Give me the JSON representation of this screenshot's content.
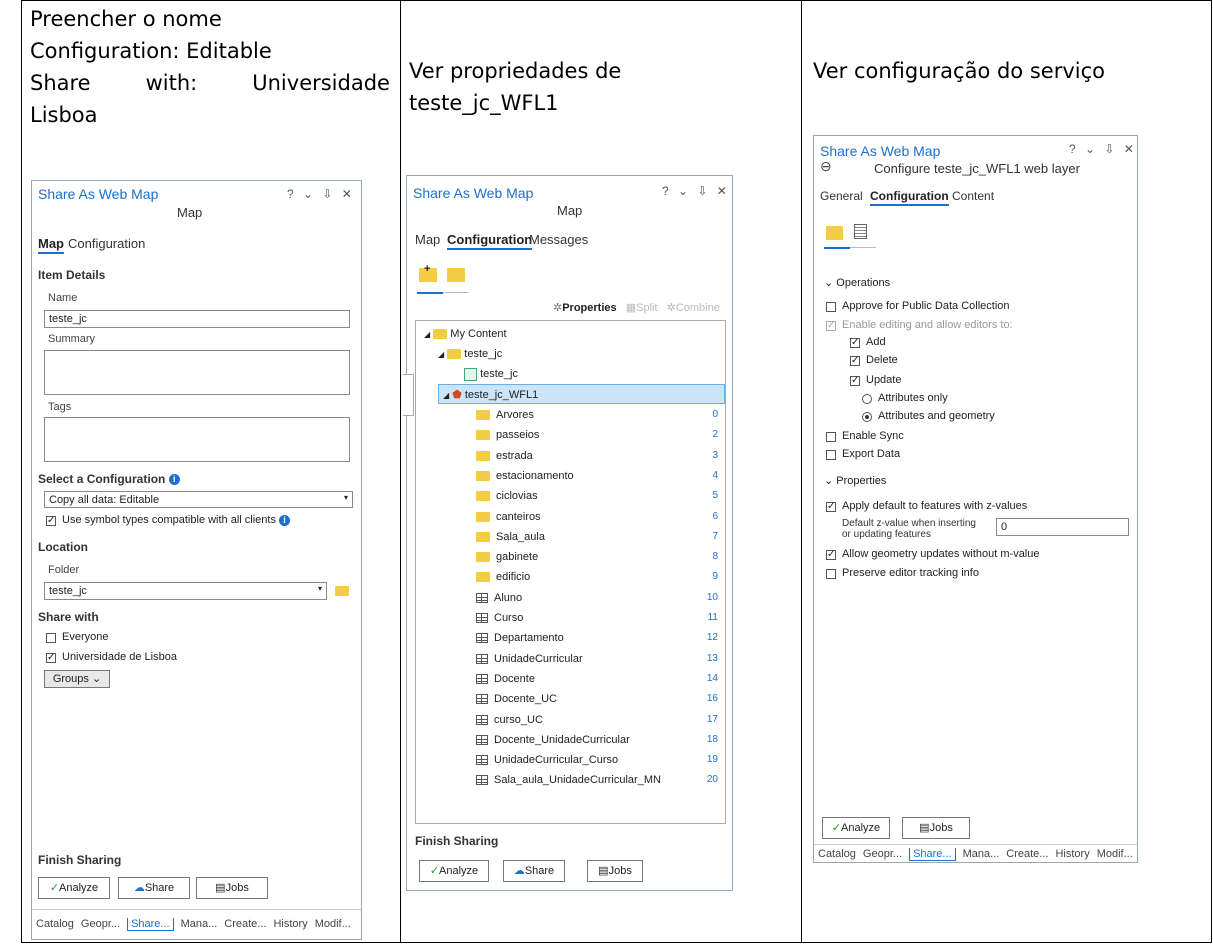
{
  "headings": {
    "col1": {
      "line1": "Preencher o nome",
      "line2": "Configuration: Editable",
      "line3_a": "Share",
      "line3_b": "with:",
      "line3_c": "Universidade",
      "line4": "Lisboa"
    },
    "col2": {
      "line1": "Ver propriedades de",
      "line2": "teste_jc_WFL1"
    },
    "col3": {
      "line1": "Ver configuração do serviço"
    }
  },
  "panel1": {
    "title": "Share As Web Map",
    "controls": "? ⌄ ⇩ ✕",
    "subtitle": "Map",
    "tabs": [
      "Map",
      "Configuration"
    ],
    "item_details": "Item Details",
    "name_label": "Name",
    "name_value": "teste_jc",
    "summary_label": "Summary",
    "tags_label": "Tags",
    "select_config": "Select a Configuration",
    "config_value": "Copy all data: Editable",
    "symbol_check": "Use symbol types compatible with all clients",
    "location": "Location",
    "folder_label": "Folder",
    "folder_value": "teste_jc",
    "share_with": "Share with",
    "everyone": "Everyone",
    "univ": "Universidade de Lisboa",
    "groups": "Groups",
    "finish": "Finish Sharing",
    "analyze": "Analyze",
    "share": "Share",
    "jobs": "Jobs",
    "bottom_tabs": [
      "Catalog",
      "Geopr...",
      "Share...",
      "Mana...",
      "Create...",
      "History",
      "Modif..."
    ]
  },
  "panel2": {
    "title": "Share As Web Map",
    "controls": "? ⌄ ⇩ ✕",
    "subtitle": "Map",
    "tabs": [
      "Map",
      "Configuration",
      "Messages"
    ],
    "toolbar": {
      "properties": "Properties",
      "split": "Split",
      "combine": "Combine"
    },
    "tree": {
      "root": "My Content",
      "folder": "teste_jc",
      "map": "teste_jc",
      "service": "teste_jc_WFL1"
    },
    "layers": [
      {
        "name": "Arvores",
        "id": "0",
        "kind": "layer"
      },
      {
        "name": "passeios",
        "id": "2",
        "kind": "layer"
      },
      {
        "name": "estrada",
        "id": "3",
        "kind": "layer"
      },
      {
        "name": "estacionamento",
        "id": "4",
        "kind": "layer"
      },
      {
        "name": "ciclovias",
        "id": "5",
        "kind": "layer"
      },
      {
        "name": "canteiros",
        "id": "6",
        "kind": "layer"
      },
      {
        "name": "Sala_aula",
        "id": "7",
        "kind": "layer"
      },
      {
        "name": "gabinete",
        "id": "8",
        "kind": "layer"
      },
      {
        "name": "edificio",
        "id": "9",
        "kind": "layer"
      },
      {
        "name": "Aluno",
        "id": "10",
        "kind": "table"
      },
      {
        "name": "Curso",
        "id": "11",
        "kind": "table"
      },
      {
        "name": "Departamento",
        "id": "12",
        "kind": "table"
      },
      {
        "name": "UnidadeCurricular",
        "id": "13",
        "kind": "table"
      },
      {
        "name": "Docente",
        "id": "14",
        "kind": "table"
      },
      {
        "name": "Docente_UC",
        "id": "16",
        "kind": "table"
      },
      {
        "name": "curso_UC",
        "id": "17",
        "kind": "table"
      },
      {
        "name": "Docente_UnidadeCurricular",
        "id": "18",
        "kind": "table"
      },
      {
        "name": "UnidadeCurricular_Curso",
        "id": "19",
        "kind": "table"
      },
      {
        "name": "Sala_aula_UnidadeCurricular_MN",
        "id": "20",
        "kind": "table"
      }
    ],
    "finish": "Finish Sharing",
    "analyze": "Analyze",
    "share": "Share",
    "jobs": "Jobs"
  },
  "panel3": {
    "title": "Share As Web Map",
    "controls": "? ⌄ ⇩ ✕",
    "subtitle": "Configure teste_jc_WFL1 web layer",
    "tabs": [
      "General",
      "Configuration",
      "Content"
    ],
    "operations": "Operations",
    "approve": "Approve for Public Data Collection",
    "enable_editing": "Enable editing and allow editors to:",
    "add": "Add",
    "delete": "Delete",
    "update": "Update",
    "attr_only": "Attributes only",
    "attr_geom": "Attributes and geometry",
    "enable_sync": "Enable Sync",
    "export": "Export Data",
    "properties": "Properties",
    "apply_z": "Apply default to features with z-values",
    "default_z_label1": "Default z-value when inserting",
    "default_z_label2": "or updating features",
    "default_z_value": "0",
    "allow_geom": "Allow geometry updates without m-value",
    "preserve": "Preserve editor tracking info",
    "analyze": "Analyze",
    "jobs": "Jobs",
    "bottom_tabs": [
      "Catalog",
      "Geopr...",
      "Share...",
      "Mana...",
      "Create...",
      "History",
      "Modif..."
    ]
  }
}
